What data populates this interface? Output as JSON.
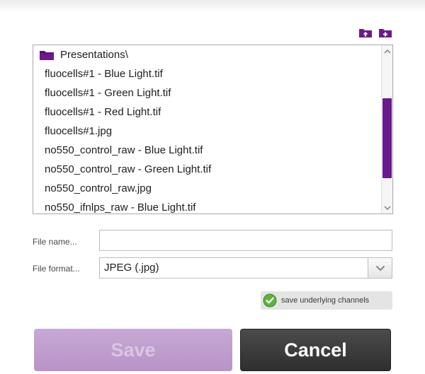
{
  "toolbar": {
    "icons": [
      "folder-up-icon",
      "new-folder-icon"
    ]
  },
  "file_list": {
    "folder": "Presentations\\",
    "files": [
      "fluocells#1 - Blue Light.tif",
      "fluocells#1 - Green Light.tif",
      "fluocells#1 - Red Light.tif",
      "fluocells#1.jpg",
      "no550_control_raw - Blue Light.tif",
      "no550_control_raw - Green Light.tif",
      "no550_control_raw.jpg",
      "no550_ifnlps_raw - Blue Light.tif"
    ],
    "scrollbar": {
      "icons": [
        "chevron-up-icon",
        "chevron-down-icon"
      ]
    }
  },
  "form": {
    "file_name_label": "File name...",
    "file_name_value": "",
    "file_format_label": "File format...",
    "file_format_value": "JPEG (.jpg)",
    "channels_label": "save underlying channels",
    "channels_checked": true
  },
  "buttons": {
    "save": "Save",
    "cancel": "Cancel"
  },
  "colors": {
    "accent": "#6a1a8d",
    "save_bg": "#c0a0cf",
    "cancel_bg": "#3a3a3a",
    "check_green": "#5fb23a"
  }
}
